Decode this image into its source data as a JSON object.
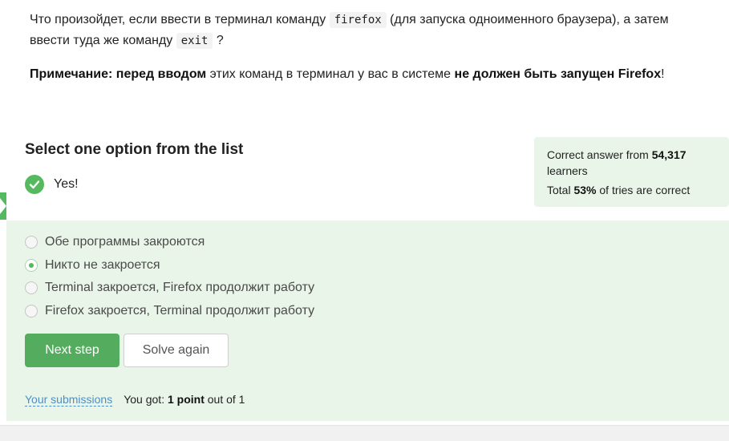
{
  "question": {
    "part1": "Что произойдет, если ввести в терминал команду",
    "code1": "firefox",
    "part2": "(для запуска одноименного браузера), а затем ввести туда же команду",
    "code2": "exit",
    "part3": "?",
    "note_bold": "Примечание: перед вводом",
    "note_text": "этих команд в терминал у вас в системе",
    "note_bold2": "не должен быть запущен Firefox",
    "note_end": "!"
  },
  "prompt": "Select one option from the list",
  "result": {
    "text": "Yes!",
    "icon": "check-icon",
    "color": "#54b95f"
  },
  "stats": {
    "prefix": "Correct answer from",
    "learners_count": "54,317",
    "learners_label": "learners",
    "total_prefix": "Total",
    "percent": "53%",
    "total_suffix": "of tries are correct"
  },
  "options": [
    {
      "label": "Обе программы закроются",
      "checked": false
    },
    {
      "label": "Никто не закроется",
      "checked": true
    },
    {
      "label": "Terminal закроется, Firefox продолжит работу",
      "checked": false
    },
    {
      "label": "Firefox закроется, Terminal продолжит работу",
      "checked": false
    }
  ],
  "buttons": {
    "next": "Next step",
    "solve_again": "Solve again"
  },
  "footer": {
    "submissions_link": "Your submissions",
    "score_prefix": "You got:",
    "score_value": "1 point",
    "score_suffix": "out of 1"
  },
  "colors": {
    "accent": "#54b95f",
    "panel": "#e9f5e9",
    "link": "#4d8fc5"
  }
}
